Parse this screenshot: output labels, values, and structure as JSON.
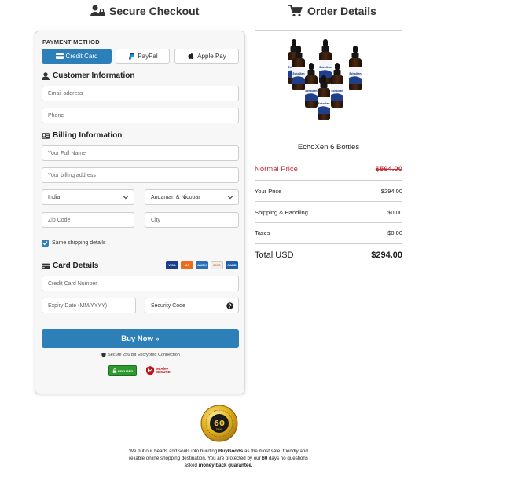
{
  "checkout": {
    "title": "Secure Checkout",
    "payment_method_label": "PAYMENT METHOD",
    "payment_methods": [
      {
        "label": "Credit Card",
        "active": true
      },
      {
        "label": "PayPal",
        "active": false
      },
      {
        "label": "Apple Pay",
        "active": false
      }
    ],
    "customer_info": {
      "title": "Customer Information",
      "email_placeholder": "Email address",
      "phone_placeholder": "Phone"
    },
    "billing_info": {
      "title": "Billing Information",
      "name_placeholder": "Your Full Name",
      "address_placeholder": "Your billing address",
      "country": "India",
      "state": "Andaman & Nicobar",
      "zip_placeholder": "Zip Code",
      "city_placeholder": "City",
      "same_shipping_label": "Same shipping details"
    },
    "card_details": {
      "title": "Card Details",
      "card_number_placeholder": "Credit Card Number",
      "expiry_placeholder": "Expiry Date (MM/YYYY)",
      "cvv_placeholder": "Security Code",
      "card_logos": [
        "VISA",
        "MC",
        "AMEX",
        "DISC",
        "CARD"
      ]
    },
    "buy_button": "Buy Now »",
    "secure_note": "Secure 256 Bit Encrypted Connection",
    "badge_secured": "SECURED",
    "badge_mcafee_line1": "McAfee",
    "badge_mcafee_line2": "SECURE"
  },
  "order": {
    "title": "Order Details",
    "product_name": "EchoXen 6 Bottles",
    "bottle_label": "EchoXen",
    "normal_price_label": "Normal Price",
    "normal_price": "$594.00",
    "your_price_label": "Your Price",
    "your_price": "$294.00",
    "shipping_label": "Shipping & Handling",
    "shipping": "$0.00",
    "taxes_label": "Taxes",
    "taxes": "$0.00",
    "total_label": "Total USD",
    "total": "$294.00"
  },
  "guarantee": {
    "seal_text": "60",
    "seal_sub": "DAYS",
    "text_1": "We put our hearts and souls into building ",
    "brand": "BuyGoods",
    "text_2": " as the most safe, friendly and reliable online shopping destination. You are protected by our ",
    "days": "60",
    "text_3": " days no questions asked ",
    "mbg": "money back guarantee."
  },
  "colors": {
    "accent": "#2d7fb8",
    "strike": "#c0303a"
  }
}
